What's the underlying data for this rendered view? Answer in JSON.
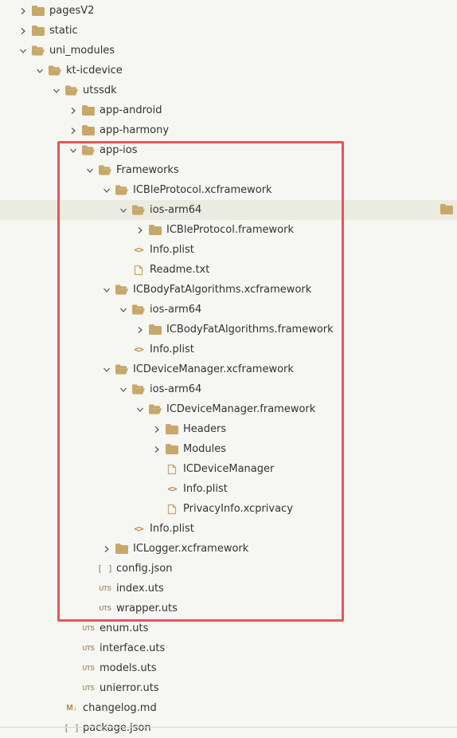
{
  "colors": {
    "folder": "#c7a86a",
    "highlight_border": "#e8545a",
    "selected_row": "#ecebe2",
    "background": "#f6f6f3",
    "text": "#333333"
  },
  "tree": [
    {
      "name": "pagesV2",
      "depth": 0,
      "kind": "folder",
      "state": "collapsed"
    },
    {
      "name": "static",
      "depth": 0,
      "kind": "folder",
      "state": "collapsed"
    },
    {
      "name": "uni_modules",
      "depth": 0,
      "kind": "folder",
      "state": "expanded"
    },
    {
      "name": "kt-icdevice",
      "depth": 1,
      "kind": "folder",
      "state": "expanded"
    },
    {
      "name": "utssdk",
      "depth": 2,
      "kind": "folder",
      "state": "expanded"
    },
    {
      "name": "app-android",
      "depth": 3,
      "kind": "folder",
      "state": "collapsed"
    },
    {
      "name": "app-harmony",
      "depth": 3,
      "kind": "folder",
      "state": "collapsed"
    },
    {
      "name": "app-ios",
      "depth": 3,
      "kind": "folder",
      "state": "expanded"
    },
    {
      "name": "Frameworks",
      "depth": 4,
      "kind": "folder",
      "state": "expanded"
    },
    {
      "name": "ICBleProtocol.xcframework",
      "depth": 5,
      "kind": "folder",
      "state": "expanded"
    },
    {
      "name": "ios-arm64",
      "depth": 6,
      "kind": "folder",
      "state": "expanded",
      "selected": true
    },
    {
      "name": "ICBleProtocol.framework",
      "depth": 7,
      "kind": "folder",
      "state": "collapsed"
    },
    {
      "name": "Info.plist",
      "depth": 6,
      "kind": "code"
    },
    {
      "name": "Readme.txt",
      "depth": 6,
      "kind": "file"
    },
    {
      "name": "ICBodyFatAlgorithms.xcframework",
      "depth": 5,
      "kind": "folder",
      "state": "expanded"
    },
    {
      "name": "ios-arm64",
      "depth": 6,
      "kind": "folder",
      "state": "expanded"
    },
    {
      "name": "ICBodyFatAlgorithms.framework",
      "depth": 7,
      "kind": "folder",
      "state": "collapsed"
    },
    {
      "name": "Info.plist",
      "depth": 6,
      "kind": "code"
    },
    {
      "name": "ICDeviceManager.xcframework",
      "depth": 5,
      "kind": "folder",
      "state": "expanded"
    },
    {
      "name": "ios-arm64",
      "depth": 6,
      "kind": "folder",
      "state": "expanded"
    },
    {
      "name": "ICDeviceManager.framework",
      "depth": 7,
      "kind": "folder",
      "state": "expanded"
    },
    {
      "name": "Headers",
      "depth": 8,
      "kind": "folder",
      "state": "collapsed"
    },
    {
      "name": "Modules",
      "depth": 8,
      "kind": "folder",
      "state": "collapsed"
    },
    {
      "name": "ICDeviceManager",
      "depth": 8,
      "kind": "file"
    },
    {
      "name": "Info.plist",
      "depth": 8,
      "kind": "code"
    },
    {
      "name": "PrivacyInfo.xcprivacy",
      "depth": 8,
      "kind": "file"
    },
    {
      "name": "Info.plist",
      "depth": 6,
      "kind": "code"
    },
    {
      "name": "ICLogger.xcframework",
      "depth": 5,
      "kind": "folder",
      "state": "collapsed"
    },
    {
      "name": "config.json",
      "depth": 4,
      "kind": "json"
    },
    {
      "name": "index.uts",
      "depth": 4,
      "kind": "uts"
    },
    {
      "name": "wrapper.uts",
      "depth": 4,
      "kind": "uts"
    },
    {
      "name": "enum.uts",
      "depth": 3,
      "kind": "uts"
    },
    {
      "name": "interface.uts",
      "depth": 3,
      "kind": "uts"
    },
    {
      "name": "models.uts",
      "depth": 3,
      "kind": "uts"
    },
    {
      "name": "unierror.uts",
      "depth": 3,
      "kind": "uts"
    },
    {
      "name": "changelog.md",
      "depth": 2,
      "kind": "md"
    },
    {
      "name": "package.json",
      "depth": 2,
      "kind": "json"
    }
  ],
  "icon_glyphs": {
    "code": "<>",
    "json": "[ ]",
    "uts": "UTS",
    "md": "M↓"
  }
}
